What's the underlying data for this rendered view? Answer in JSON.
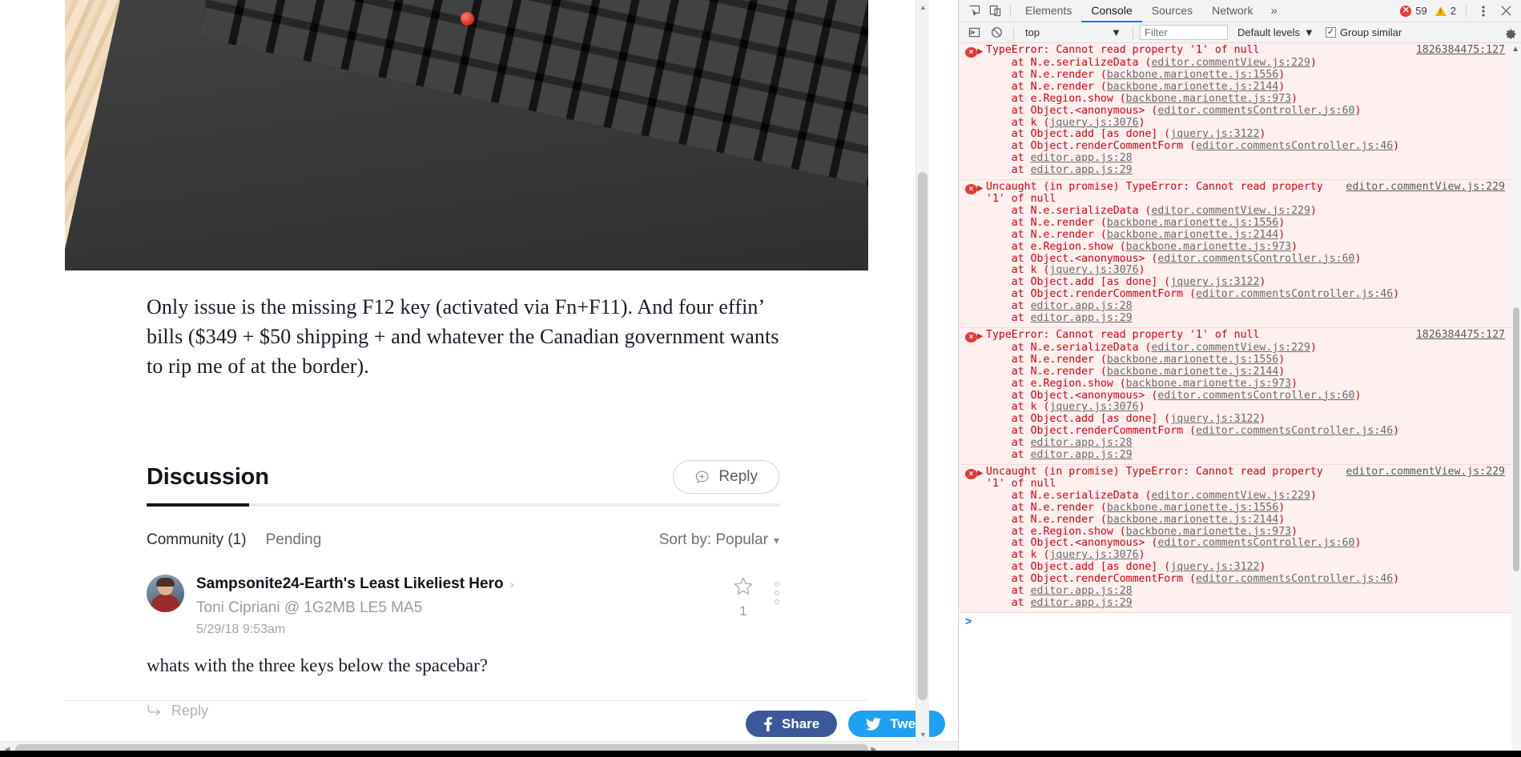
{
  "page": {
    "hero_alt": "mechanical-keyboard-on-wooden-desk",
    "article_paragraph": "Only issue is the missing F12 key (activated via Fn+F11). And four effin’ bills ($349 + $50 shipping + and whatever the Canadian government wants to rip me of at the border).",
    "discussion": {
      "title": "Discussion",
      "reply_button": "Reply",
      "tabs": [
        {
          "label": "Community (1)",
          "active": true
        },
        {
          "label": "Pending",
          "active": false
        }
      ],
      "sort_label": "Sort by: Popular",
      "sort_chevron": "chevron-down"
    },
    "comment": {
      "author": "Sampsonite24-Earth's Least Likeliest Hero",
      "reply_arrow": "›",
      "recipient": "Toni Cipriani @ 1G2MB LE5 MA5",
      "date": "5/29/18 9:53am",
      "body": "whats with the three keys below the spacebar?",
      "star_count": "1",
      "reply_link": "Reply"
    },
    "social": {
      "facebook_label": "Share",
      "facebook_color": "#3b5998",
      "twitter_label": "Tweet",
      "twitter_color": "#1da1f2"
    }
  },
  "devtools": {
    "toolbar": {
      "inspect_icon": "inspect-element-icon",
      "device_icon": "device-toolbar-icon",
      "tabs": [
        {
          "label": "Elements",
          "active": false
        },
        {
          "label": "Console",
          "active": true
        },
        {
          "label": "Sources",
          "active": false
        },
        {
          "label": "Network",
          "active": false
        }
      ],
      "more_tabs": "»",
      "error_count": "59",
      "warning_count": "2",
      "menu_icon": "kebab-menu-icon",
      "close_icon": "close-icon"
    },
    "filterbar": {
      "execute_icon": "execute-snippet-icon",
      "clear_icon": "clear-console-icon",
      "context": "top",
      "filter_placeholder": "Filter",
      "levels_label": "Default levels",
      "group_similar_label": "Group similar",
      "group_similar_checked": true,
      "settings_icon": "gear-icon"
    },
    "prompt": ">",
    "messages": [
      {
        "title": "TypeError: Cannot read property '1' of null",
        "source": "1826384475:127",
        "inline_source": false,
        "stack": [
          {
            "prefix": "    at N.e.serializeData (",
            "link": "editor.commentView.js:229",
            "suffix": ")"
          },
          {
            "prefix": "    at N.e.render (",
            "link": "backbone.marionette.js:1556",
            "suffix": ")"
          },
          {
            "prefix": "    at N.e.render (",
            "link": "backbone.marionette.js:2144",
            "suffix": ")"
          },
          {
            "prefix": "    at e.Region.show (",
            "link": "backbone.marionette.js:973",
            "suffix": ")"
          },
          {
            "prefix": "    at Object.<anonymous> (",
            "link": "editor.commentsController.js:60",
            "suffix": ")"
          },
          {
            "prefix": "    at k (",
            "link": "jquery.js:3076",
            "suffix": ")"
          },
          {
            "prefix": "    at Object.add [as done] (",
            "link": "jquery.js:3122",
            "suffix": ")"
          },
          {
            "prefix": "    at Object.renderCommentForm (",
            "link": "editor.commentsController.js:46",
            "suffix": ")"
          },
          {
            "prefix": "    at ",
            "link": "editor.app.js:28",
            "suffix": ""
          },
          {
            "prefix": "    at ",
            "link": "editor.app.js:29",
            "suffix": ""
          }
        ]
      },
      {
        "title": "Uncaught (in promise) TypeError: Cannot read property '1' of null",
        "source": "editor.commentView.js:229",
        "inline_source": true,
        "stack": [
          {
            "prefix": "    at N.e.serializeData (",
            "link": "editor.commentView.js:229",
            "suffix": ")"
          },
          {
            "prefix": "    at N.e.render (",
            "link": "backbone.marionette.js:1556",
            "suffix": ")"
          },
          {
            "prefix": "    at N.e.render (",
            "link": "backbone.marionette.js:2144",
            "suffix": ")"
          },
          {
            "prefix": "    at e.Region.show (",
            "link": "backbone.marionette.js:973",
            "suffix": ")"
          },
          {
            "prefix": "    at Object.<anonymous> (",
            "link": "editor.commentsController.js:60",
            "suffix": ")"
          },
          {
            "prefix": "    at k (",
            "link": "jquery.js:3076",
            "suffix": ")"
          },
          {
            "prefix": "    at Object.add [as done] (",
            "link": "jquery.js:3122",
            "suffix": ")"
          },
          {
            "prefix": "    at Object.renderCommentForm (",
            "link": "editor.commentsController.js:46",
            "suffix": ")"
          },
          {
            "prefix": "    at ",
            "link": "editor.app.js:28",
            "suffix": ""
          },
          {
            "prefix": "    at ",
            "link": "editor.app.js:29",
            "suffix": ""
          }
        ]
      },
      {
        "title": "TypeError: Cannot read property '1' of null",
        "source": "1826384475:127",
        "inline_source": false,
        "stack": [
          {
            "prefix": "    at N.e.serializeData (",
            "link": "editor.commentView.js:229",
            "suffix": ")"
          },
          {
            "prefix": "    at N.e.render (",
            "link": "backbone.marionette.js:1556",
            "suffix": ")"
          },
          {
            "prefix": "    at N.e.render (",
            "link": "backbone.marionette.js:2144",
            "suffix": ")"
          },
          {
            "prefix": "    at e.Region.show (",
            "link": "backbone.marionette.js:973",
            "suffix": ")"
          },
          {
            "prefix": "    at Object.<anonymous> (",
            "link": "editor.commentsController.js:60",
            "suffix": ")"
          },
          {
            "prefix": "    at k (",
            "link": "jquery.js:3076",
            "suffix": ")"
          },
          {
            "prefix": "    at Object.add [as done] (",
            "link": "jquery.js:3122",
            "suffix": ")"
          },
          {
            "prefix": "    at Object.renderCommentForm (",
            "link": "editor.commentsController.js:46",
            "suffix": ")"
          },
          {
            "prefix": "    at ",
            "link": "editor.app.js:28",
            "suffix": ""
          },
          {
            "prefix": "    at ",
            "link": "editor.app.js:29",
            "suffix": ""
          }
        ]
      },
      {
        "title": "Uncaught (in promise) TypeError: Cannot read property '1' of null",
        "source": "editor.commentView.js:229",
        "inline_source": true,
        "stack": [
          {
            "prefix": "    at N.e.serializeData (",
            "link": "editor.commentView.js:229",
            "suffix": ")"
          },
          {
            "prefix": "    at N.e.render (",
            "link": "backbone.marionette.js:1556",
            "suffix": ")"
          },
          {
            "prefix": "    at N.e.render (",
            "link": "backbone.marionette.js:2144",
            "suffix": ")"
          },
          {
            "prefix": "    at e.Region.show (",
            "link": "backbone.marionette.js:973",
            "suffix": ")"
          },
          {
            "prefix": "    at Object.<anonymous> (",
            "link": "editor.commentsController.js:60",
            "suffix": ")"
          },
          {
            "prefix": "    at k (",
            "link": "jquery.js:3076",
            "suffix": ")"
          },
          {
            "prefix": "    at Object.add [as done] (",
            "link": "jquery.js:3122",
            "suffix": ")"
          },
          {
            "prefix": "    at Object.renderCommentForm (",
            "link": "editor.commentsController.js:46",
            "suffix": ")"
          },
          {
            "prefix": "    at ",
            "link": "editor.app.js:28",
            "suffix": ""
          },
          {
            "prefix": "    at ",
            "link": "editor.app.js:29",
            "suffix": ""
          }
        ]
      }
    ]
  }
}
